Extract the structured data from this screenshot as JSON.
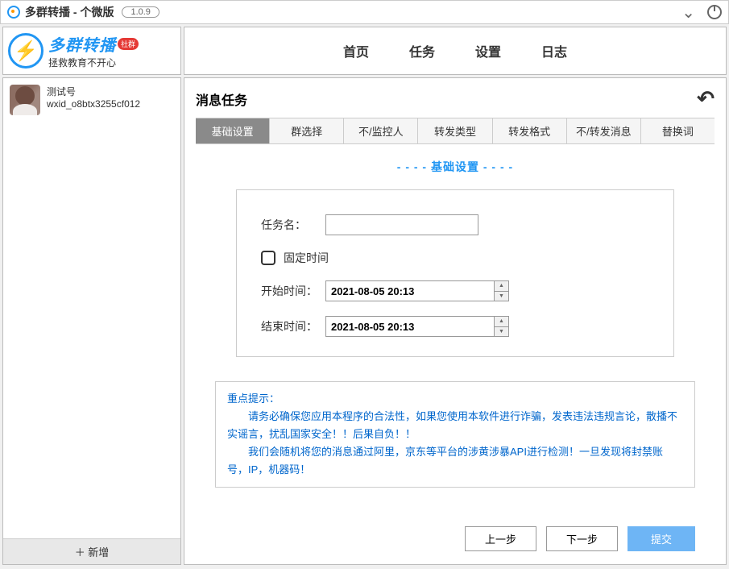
{
  "titlebar": {
    "title": "多群转播 - 个微版",
    "version": "1.0.9"
  },
  "brand": {
    "title": "多群转播",
    "badge": "社群",
    "subtitle": "拯救教育不开心"
  },
  "account": {
    "name": "测试号",
    "id": "wxid_o8btx3255cf012"
  },
  "sidebar": {
    "add_label": "＋ 新增"
  },
  "nav": {
    "items": [
      "首页",
      "任务",
      "设置",
      "日志"
    ]
  },
  "content": {
    "title": "消息任务",
    "tabs": [
      "基础设置",
      "群选择",
      "不/监控人",
      "转发类型",
      "转发格式",
      "不/转发消息",
      "替换词"
    ],
    "section_title": "- - - - 基础设置 - - - -"
  },
  "form": {
    "task_name_label": "任务名：",
    "task_name_value": "",
    "fixed_time_label": "固定时间",
    "start_time_label": "开始时间：",
    "start_time_value": "2021-08-05 20:13",
    "end_time_label": "结束时间：",
    "end_time_value": "2021-08-05 20:13"
  },
  "notice": {
    "title": "重点提示：",
    "line1": "请务必确保您应用本程序的合法性，如果您使用本软件进行诈骗，发表违法违规言论，散播不实谣言，扰乱国家安全！！后果自负！！",
    "line2": "我们会随机将您的消息通过阿里，京东等平台的涉黄涉暴API进行检测！一旦发现将封禁账号，IP，机器码！"
  },
  "buttons": {
    "prev": "上一步",
    "next": "下一步",
    "submit": "提交"
  }
}
